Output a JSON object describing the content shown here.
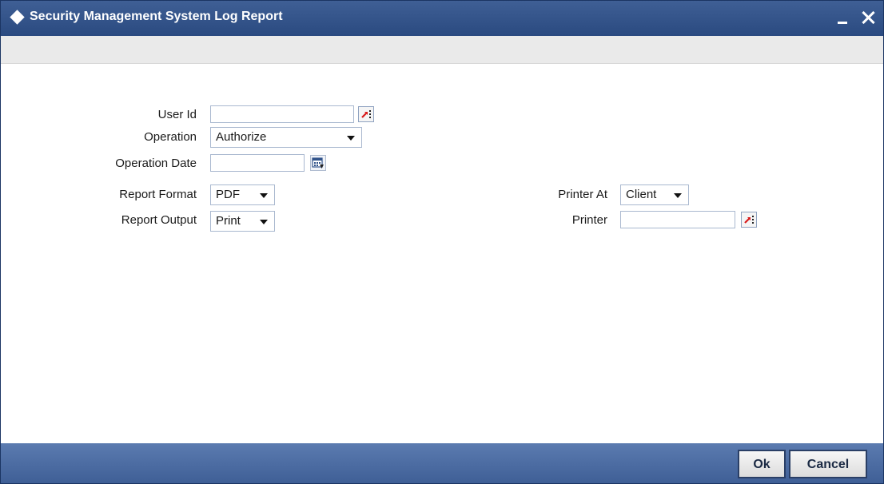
{
  "window": {
    "title": "Security Management System Log Report",
    "minimize_icon": "minimize-icon",
    "close_icon": "close-icon",
    "title_icon": "diamond-icon"
  },
  "form": {
    "user_id": {
      "label": "User Id",
      "value": ""
    },
    "operation": {
      "label": "Operation",
      "selected": "Authorize"
    },
    "operation_date": {
      "label": "Operation Date",
      "value": ""
    },
    "report_format": {
      "label": "Report Format",
      "selected": "PDF"
    },
    "report_output": {
      "label": "Report Output",
      "selected": "Print"
    },
    "printer_at": {
      "label": "Printer At",
      "selected": "Client"
    },
    "printer": {
      "label": "Printer",
      "value": ""
    }
  },
  "footer": {
    "ok_label": "Ok",
    "cancel_label": "Cancel"
  },
  "colors": {
    "titlebar": "#2f4f86",
    "footer": "#4a6aa0",
    "toolbar": "#eaeaea",
    "lov_arrow": "#d81b1b"
  }
}
